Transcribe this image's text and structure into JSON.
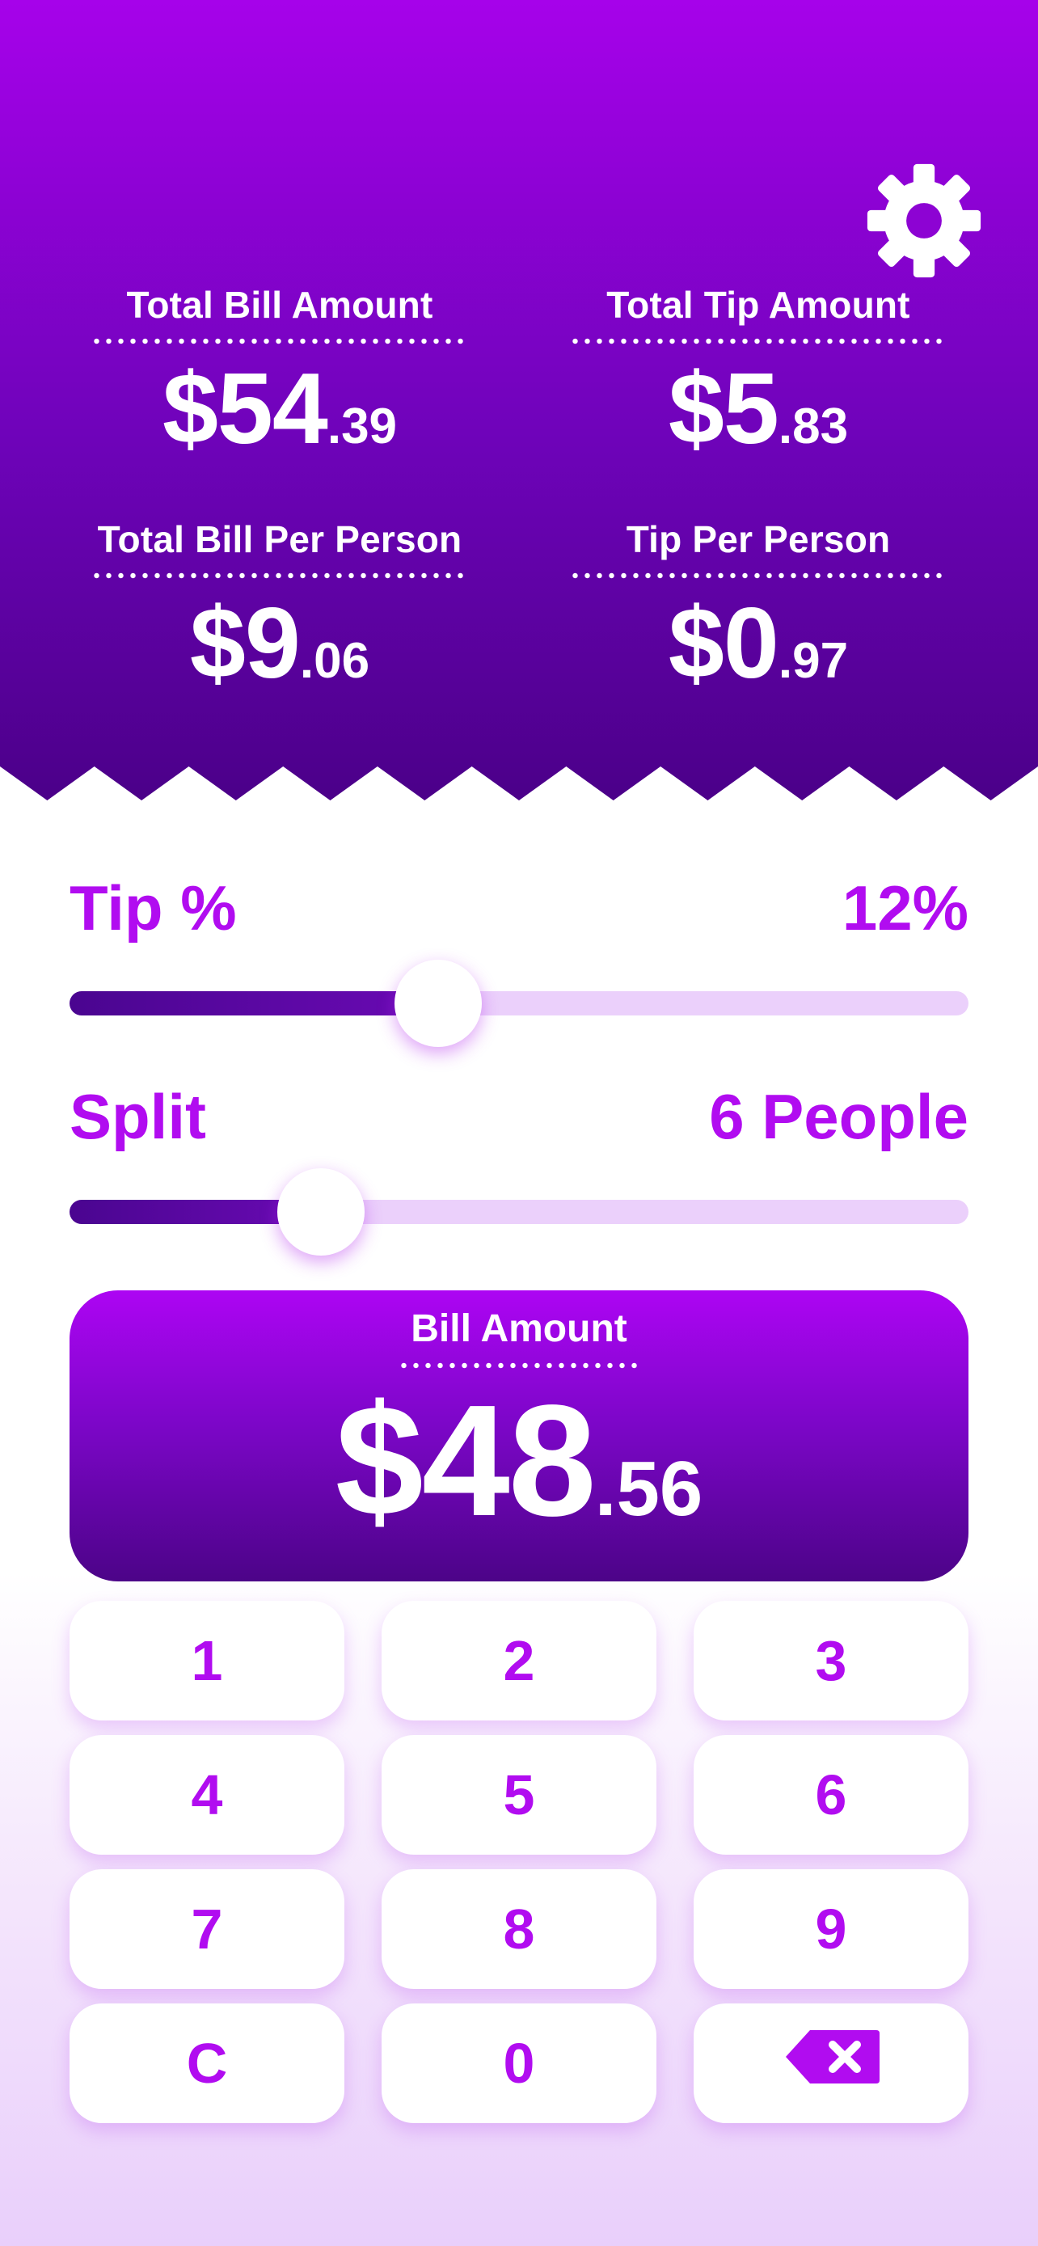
{
  "summary": {
    "total_bill": {
      "label": "Total Bill Amount",
      "dollars": "$54",
      "cents": ".39"
    },
    "total_tip": {
      "label": "Total Tip Amount",
      "dollars": "$5",
      "cents": ".83"
    },
    "bill_per_person": {
      "label": "Total Bill Per Person",
      "dollars": "$9",
      "cents": ".06"
    },
    "tip_per_person": {
      "label": "Tip Per Person",
      "dollars": "$0",
      "cents": ".97"
    }
  },
  "settings_icon": "gear-icon",
  "tip": {
    "label": "Tip %",
    "value_text": "12%",
    "level_fraction": 0.41
  },
  "split": {
    "label": "Split",
    "value_text": "6 People",
    "level_fraction": 0.28
  },
  "bill": {
    "label": "Bill Amount",
    "dollars": "$48",
    "cents": ".56"
  },
  "keypad": {
    "k1": "1",
    "k2": "2",
    "k3": "3",
    "k4": "4",
    "k5": "5",
    "k6": "6",
    "k7": "7",
    "k8": "8",
    "k9": "9",
    "clear": "C",
    "k0": "0",
    "backspace_icon": "backspace-icon"
  },
  "colors": {
    "accent": "#b10cf0",
    "header_top": "#a602ea",
    "header_bottom": "#4b0089",
    "track": "#ebd0fb"
  }
}
